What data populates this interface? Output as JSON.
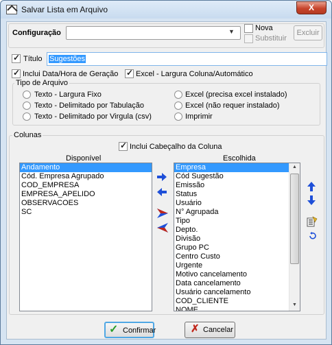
{
  "window": {
    "title": "Salvar Lista em Arquivo",
    "close_label": "X"
  },
  "config": {
    "label": "Configuração",
    "value": "",
    "nova_label": "Nova",
    "substituir_label": "Substituir",
    "excluir_label": "Excluir"
  },
  "titulo": {
    "label": "Título",
    "value": "Sugestões"
  },
  "options": {
    "incluir_data_label": "Inclui Data/Hora de Geração",
    "excel_largura_label": "Excel - Largura Coluna/Automático"
  },
  "tipo_arquivo": {
    "title": "Tipo de Arquivo",
    "left": [
      "Texto - Largura Fixo",
      "Texto - Delimitado por Tabulação",
      "Texto - Delimitado por Virgula (csv)"
    ],
    "right": [
      "Excel (precisa excel instalado)",
      "Excel (não requer instalado)",
      "Imprimir"
    ]
  },
  "colunas": {
    "title": "Colunas",
    "incluir_cabecalho_label": "Inclui Cabeçalho da Coluna",
    "disponivel_label": "Disponível",
    "escolhida_label": "Escolhida",
    "disponivel": [
      "Andamento",
      "Cód. Empresa Agrupado",
      "COD_EMPRESA",
      "EMPRESA_APELIDO",
      "OBSERVACOES",
      "SC"
    ],
    "escolhida": [
      "Empresa",
      "Cód Sugestão",
      "Emissão",
      "Status",
      "Usuário",
      "N° Agrupada",
      "Tipo",
      "Depto.",
      "Divisão",
      "Grupo PC",
      "Centro Custo",
      "Urgente",
      "Motivo cancelamento",
      "Data cancelamento",
      "Usuário cancelamento",
      "COD_CLIENTE",
      "NOME"
    ]
  },
  "buttons": {
    "confirmar_label": "Confirmar",
    "cancelar_label": "Cancelar"
  },
  "colors": {
    "selection": "#3399ff",
    "arrow_blue": "#1e4fd8",
    "confirm_green": "#2a9d2a",
    "cancel_red": "#c0281c"
  }
}
